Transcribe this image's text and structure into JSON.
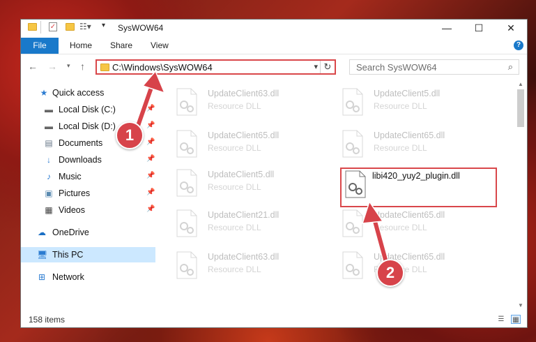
{
  "window": {
    "title": "SysWOW64"
  },
  "ribbon": {
    "file_tab": "File",
    "tabs": [
      "Home",
      "Share",
      "View"
    ],
    "help_label": "?"
  },
  "address": {
    "path": "C:\\Windows\\SysWOW64"
  },
  "search": {
    "placeholder": "Search SysWOW64"
  },
  "sidebar": {
    "items": [
      {
        "label": "Quick access",
        "icon": "star-icon",
        "pinned": false
      },
      {
        "label": "Local Disk (C:)",
        "icon": "drive-icon",
        "pinned": true
      },
      {
        "label": "Local Disk (D:)",
        "icon": "drive-icon",
        "pinned": true
      },
      {
        "label": "Documents",
        "icon": "document-icon",
        "pinned": true
      },
      {
        "label": "Downloads",
        "icon": "download-icon",
        "pinned": true
      },
      {
        "label": "Music",
        "icon": "music-icon",
        "pinned": true
      },
      {
        "label": "Pictures",
        "icon": "pictures-icon",
        "pinned": true
      },
      {
        "label": "Videos",
        "icon": "video-icon",
        "pinned": true
      },
      {
        "label": "OneDrive",
        "icon": "cloud-icon",
        "pinned": false
      },
      {
        "label": "This PC",
        "icon": "computer-icon",
        "pinned": false,
        "selected": true
      },
      {
        "label": "Network",
        "icon": "network-icon",
        "pinned": false
      }
    ]
  },
  "files": [
    {
      "name": "UpdateClient63.dll",
      "desc": "Resource DLL"
    },
    {
      "name": "UpdateClient5.dll",
      "desc": "Resource DLL"
    },
    {
      "name": "UpdateClient65.dll",
      "desc": "Resource DLL"
    },
    {
      "name": "UpdateClient65.dll",
      "desc": "Resource DLL"
    },
    {
      "name": "UpdateClient5.dll",
      "desc": "Resource DLL"
    },
    {
      "name": "libi420_yuy2_plugin.dll",
      "desc": "",
      "highlighted": true
    },
    {
      "name": "UpdateClient21.dll",
      "desc": "Resource DLL"
    },
    {
      "name": "UpdateClient65.dll",
      "desc": "Resource DLL"
    },
    {
      "name": "UpdateClient63.dll",
      "desc": "Resource DLL"
    },
    {
      "name": "UpdateClient65.dll",
      "desc": "Resource DLL"
    }
  ],
  "status": {
    "items_count": "158 items"
  },
  "callouts": [
    "1",
    "2"
  ],
  "colors": {
    "accent": "#1979ca",
    "highlight": "#d9474a",
    "callout": "#d7434a",
    "selection": "#cce8ff"
  }
}
